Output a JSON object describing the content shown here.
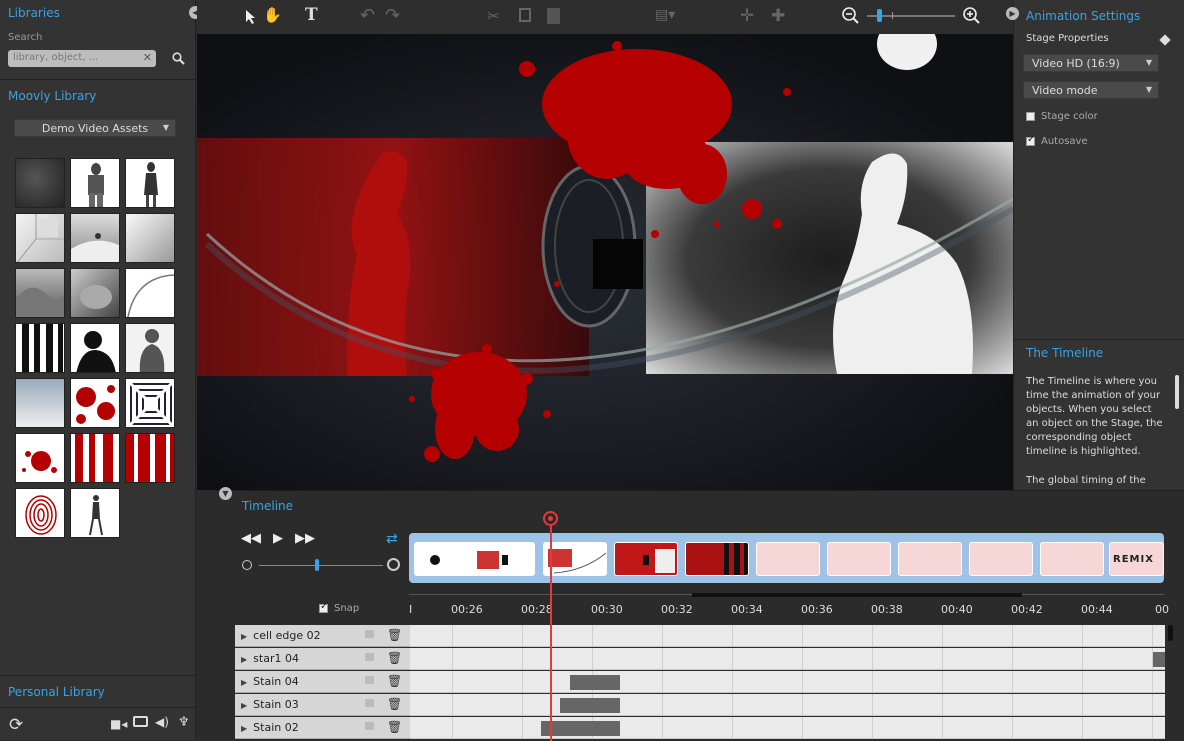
{
  "left": {
    "libraries_title": "Libraries",
    "search_label": "Search",
    "search_placeholder": "library, object, ...",
    "moovly_library_title": "Moovly Library",
    "asset_dropdown": "Demo Video Assets",
    "personal_library_title": "Personal Library"
  },
  "toolbar": {
    "text_tool": "T"
  },
  "right": {
    "animation_settings_title": "Animation Settings",
    "stage_properties": "Stage Properties",
    "resolution": "Video HD (16:9)",
    "mode": "Video mode",
    "stage_color_label": "Stage color",
    "autosave_label": "Autosave",
    "timeline_help_title": "The Timeline",
    "timeline_help_text": "The Timeline is where you time the animation of your objects. When you select an object on the Stage, the corresponding object timeline is highlighted.",
    "timeline_help_more": "The global timing of the"
  },
  "timeline": {
    "title": "Timeline",
    "snap_label": "Snap",
    "clip_last_label": "REMIX",
    "ticks": [
      "I",
      "00:26",
      "00:28",
      "00:30",
      "00:32",
      "00:34",
      "00:36",
      "00:38",
      "00:40",
      "00:42",
      "00:44",
      "00"
    ],
    "rows": [
      {
        "name": "cell edge 02"
      },
      {
        "name": "star1 04"
      },
      {
        "name": "Stain 04"
      },
      {
        "name": "Stain 03"
      },
      {
        "name": "Stain 02"
      }
    ]
  },
  "colors": {
    "accent": "#3aa3e3",
    "playhead": "#e23b3b",
    "blood": "#b40000"
  }
}
